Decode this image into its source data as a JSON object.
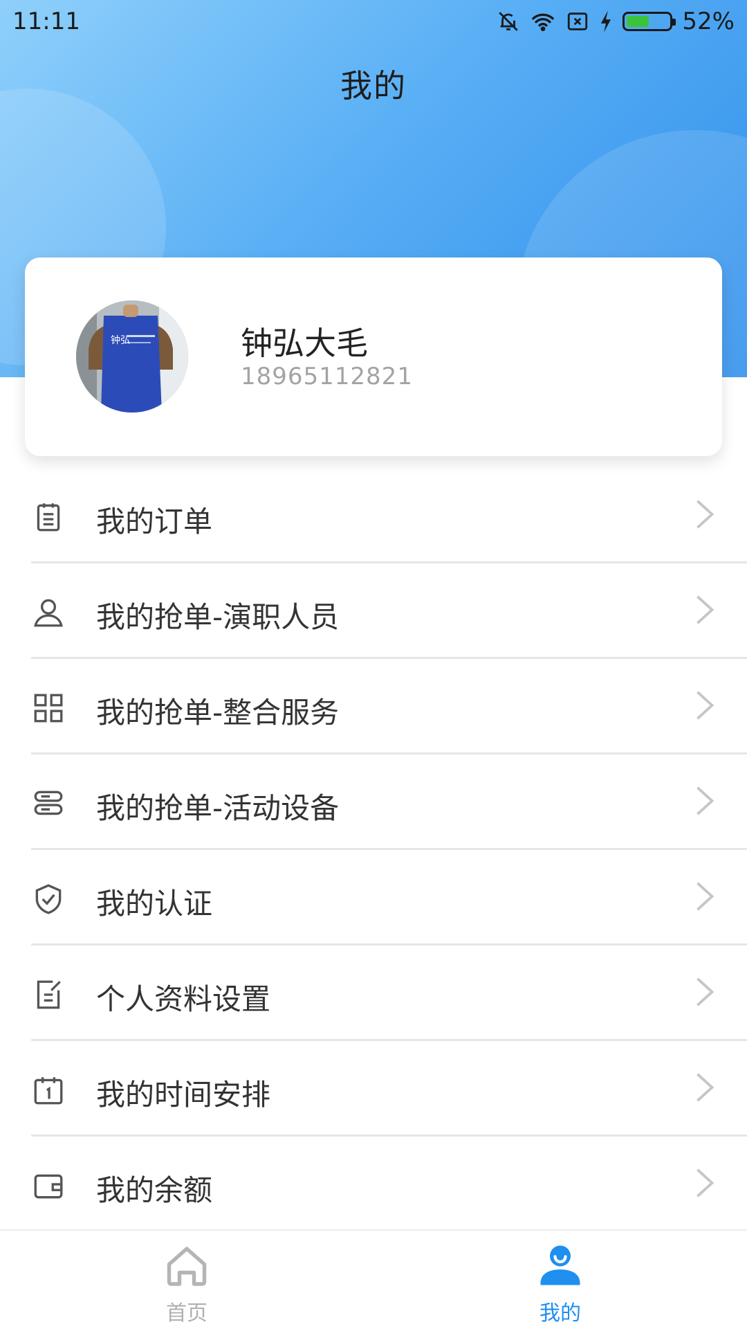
{
  "status_bar": {
    "time": "11:11",
    "battery_percent": "52%",
    "battery_level": 0.52,
    "icons": [
      "bell-off-icon",
      "wifi-icon",
      "sim-x-icon",
      "charging-bolt-icon",
      "battery-icon"
    ]
  },
  "header": {
    "title": "我的"
  },
  "profile": {
    "name": "钟弘大毛",
    "phone": "18965112821",
    "avatar_caption": "钟弘"
  },
  "menu": {
    "items": [
      {
        "label": "我的订单",
        "icon": "clipboard-icon"
      },
      {
        "label": "我的抢单-演职人员",
        "icon": "person-icon"
      },
      {
        "label": "我的抢单-整合服务",
        "icon": "grid-icon"
      },
      {
        "label": "我的抢单-活动设备",
        "icon": "device-stack-icon"
      },
      {
        "label": "我的认证",
        "icon": "shield-check-icon"
      },
      {
        "label": "个人资料设置",
        "icon": "edit-note-icon"
      },
      {
        "label": "我的时间安排",
        "icon": "calendar-icon"
      },
      {
        "label": "我的余额",
        "icon": "wallet-icon"
      }
    ]
  },
  "bottom_nav": {
    "home_label": "首页",
    "mine_label": "我的",
    "active": "我的"
  },
  "colors": {
    "accent": "#1f8ff0",
    "header_gradient_start": "#8fd0fb",
    "header_gradient_end": "#2f8fec",
    "divider": "#e6e6e6"
  }
}
